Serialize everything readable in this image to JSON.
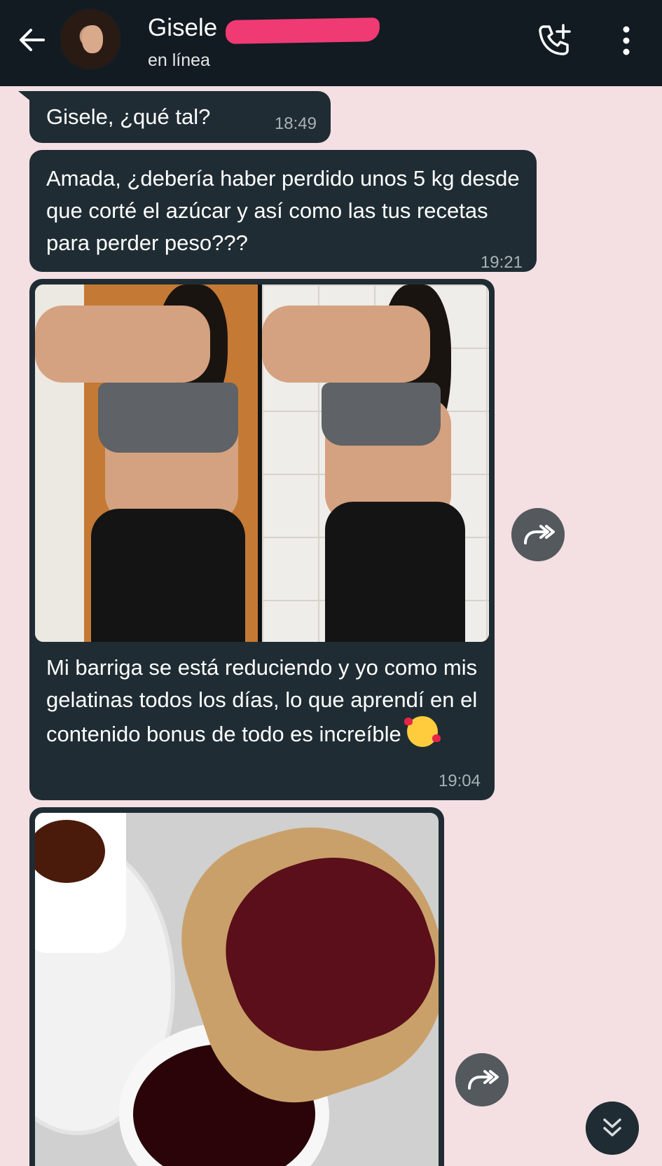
{
  "header": {
    "contact_name": "Gisele",
    "status": "en línea",
    "icons": {
      "back": "arrow-left-icon",
      "call": "add-call-icon",
      "menu": "more-vertical-icon"
    },
    "redaction_color": "#f03a73"
  },
  "messages": [
    {
      "text": "Gisele, ¿qué tal?",
      "time": "18:49"
    },
    {
      "text": "Amada, ¿debería haber perdido unos 5 kg desde que corté el azúcar y así como las tus recetas para perder peso???",
      "time": "19:21"
    },
    {
      "text": "Mi barriga se está reduciendo y yo como mis gelatinas todos los días, lo que aprendí en el contenido bonus de todo es increíble",
      "emoji": "smiling-face-with-hearts",
      "time": "19:04"
    },
    {
      "image": "toast-with-jam-photo"
    }
  ],
  "colors": {
    "chat_background": "#f4dfe2",
    "bubble": "#1f2c33",
    "header": "#111b21"
  }
}
